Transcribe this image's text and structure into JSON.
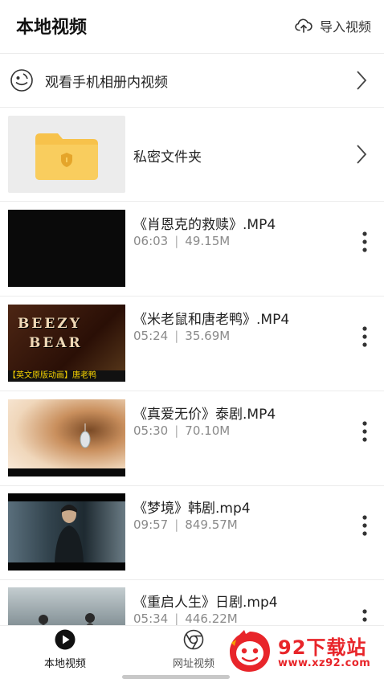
{
  "header": {
    "title": "本地视频",
    "import_label": "导入视频"
  },
  "album_row": {
    "label": "观看手机相册内视频"
  },
  "private_folder": {
    "label": "私密文件夹"
  },
  "videos": [
    {
      "name": "《肖恩克的救赎》.MP4",
      "duration": "06:03",
      "size": "49.15M"
    },
    {
      "name": "《米老鼠和唐老鸭》.MP4",
      "duration": "05:24",
      "size": "35.69M",
      "thumb_text_1": "BEEZY",
      "thumb_text_2": "BEAR",
      "thumb_caption": "【英文原版动画】唐老鸭"
    },
    {
      "name": "《真爱无价》泰剧.MP4",
      "duration": "05:30",
      "size": "70.10M"
    },
    {
      "name": "《梦境》韩剧.mp4",
      "duration": "09:57",
      "size": "849.57M"
    },
    {
      "name": "《重启人生》日剧.mp4",
      "duration": "05:34",
      "size": "446.22M"
    }
  ],
  "tabs": [
    {
      "label": "本地视频",
      "icon": "play-circle-icon",
      "active": true
    },
    {
      "label": "网址视频",
      "icon": "browser-icon",
      "active": false
    }
  ],
  "watermark": {
    "brand": "92下载站",
    "url": "www.xz92.com"
  },
  "colors": {
    "accent": "#111111",
    "folder": "#f7c24b",
    "watermark_red": "#e8252a"
  }
}
